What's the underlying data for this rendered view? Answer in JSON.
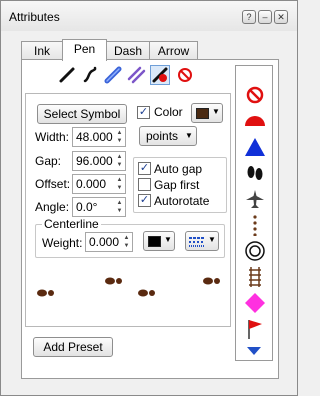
{
  "window": {
    "title": "Attributes"
  },
  "tabs": [
    "Ink",
    "Pen",
    "Dash",
    "Arrow"
  ],
  "tools": [
    "pen-icon",
    "brush-icon",
    "marker-icon",
    "double-line-icon",
    "symbol-pen-icon",
    "eraser-icon"
  ],
  "form": {
    "select_symbol_label": "Select Symbol",
    "color_label": "Color",
    "color_value": "#4a2a12",
    "width_label": "Width:",
    "width_value": "48.000",
    "units_value": "points",
    "gap_label": "Gap:",
    "gap_value": "96.000",
    "offset_label": "Offset:",
    "offset_value": "0.000",
    "angle_label": "Angle:",
    "angle_value": "0.0°",
    "auto_gap_label": "Auto gap",
    "gap_first_label": "Gap first",
    "autorotate_label": "Autorotate",
    "centerline_label": "Centerline",
    "weight_label": "Weight:",
    "weight_value": "0.000",
    "centerline_color": "#000000"
  },
  "footer": {
    "add_preset_label": "Add Preset"
  },
  "symbol_strip": {
    "items": [
      "no-sign-icon",
      "red-half-circle-icon",
      "blue-triangle-icon",
      "footprints-icon",
      "airplane-icon",
      "dotted-path-icon",
      "target-icon",
      "railroad-track-icon",
      "magenta-diamond-icon",
      "red-flag-icon"
    ]
  },
  "colors": {
    "selection": "#dbe9f9",
    "accent_blue": "#2150c7",
    "red": "#e01010",
    "brown": "#4a2a12"
  }
}
